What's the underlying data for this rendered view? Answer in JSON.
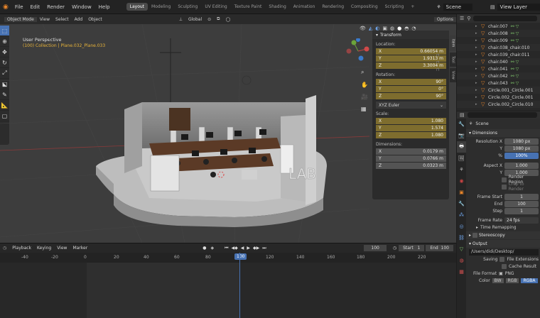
{
  "menubar": {
    "menus": [
      "File",
      "Edit",
      "Render",
      "Window",
      "Help"
    ],
    "workspaces": [
      "Layout",
      "Modeling",
      "Sculpting",
      "UV Editing",
      "Texture Paint",
      "Shading",
      "Animation",
      "Rendering",
      "Compositing",
      "Scripting"
    ],
    "active_workspace": "Layout",
    "scene": "Scene",
    "view_layer": "View Layer"
  },
  "viewport": {
    "mode": "Object Mode",
    "menus": [
      "View",
      "Select",
      "Add",
      "Object"
    ],
    "transform_orientation": "Global",
    "options_label": "Options",
    "view_name": "User Perspective",
    "collection_path": "(100) Collection | Plane.032_Plane.033"
  },
  "npanel": {
    "title": "Transform",
    "location_label": "Location:",
    "location": [
      {
        "axis": "X",
        "value": "0.66054 m"
      },
      {
        "axis": "Y",
        "value": "1.9313 m"
      },
      {
        "axis": "Z",
        "value": "3.3004 m"
      }
    ],
    "rotation_label": "Rotation:",
    "rotation": [
      {
        "axis": "X",
        "value": "90°"
      },
      {
        "axis": "Y",
        "value": "0°"
      },
      {
        "axis": "Z",
        "value": "90°"
      }
    ],
    "rotation_mode": "XYZ Euler",
    "scale_label": "Scale:",
    "scale": [
      {
        "axis": "X",
        "value": "1.080"
      },
      {
        "axis": "Y",
        "value": "1.574"
      },
      {
        "axis": "Z",
        "value": "1.080"
      }
    ],
    "dimensions_label": "Dimensions:",
    "dimensions": [
      {
        "axis": "X",
        "value": "0.0179 m"
      },
      {
        "axis": "Y",
        "value": "0.0766 m"
      },
      {
        "axis": "Z",
        "value": "0.0323 m"
      }
    ],
    "tabs": [
      "Item",
      "Tool",
      "View"
    ]
  },
  "timeline": {
    "menus": [
      "Playback",
      "Keying",
      "View",
      "Marker"
    ],
    "current_frame": "100",
    "start_label": "Start",
    "start": "1",
    "end_label": "End",
    "end": "100",
    "ruler_ticks": [
      "-40",
      "-20",
      "0",
      "20",
      "40",
      "60",
      "80",
      "100",
      "120",
      "140",
      "160",
      "180",
      "200",
      "220"
    ]
  },
  "outliner": {
    "items": [
      {
        "name": "chair.007"
      },
      {
        "name": "chair.008"
      },
      {
        "name": "chair.009"
      },
      {
        "name": "chair.038_chair.010"
      },
      {
        "name": "chair.039_chair.011"
      },
      {
        "name": "chair.040"
      },
      {
        "name": "chair.041"
      },
      {
        "name": "chair.042"
      },
      {
        "name": "chair.043"
      },
      {
        "name": "Circle.001_Circle.001"
      },
      {
        "name": "Circle.002_Circle.001"
      },
      {
        "name": "Circle.002_Circle.010"
      }
    ]
  },
  "properties": {
    "scene_label": "Scene",
    "dimensions_header": "Dimensions",
    "resolution_x_label": "Resolution X",
    "resolution_x": "1080 px",
    "resolution_y_label": "Y",
    "resolution_y": "1080 px",
    "percent_label": "%",
    "percent": "100%",
    "aspect_x_label": "Aspect X",
    "aspect_x": "1.000",
    "aspect_y_label": "Y",
    "aspect_y": "1.000",
    "render_region": "Render Region",
    "crop_to_render": "Crop to Render",
    "frame_start_label": "Frame Start",
    "frame_start": "1",
    "end_label": "End",
    "end": "100",
    "step_label": "Step",
    "step": "1",
    "frame_rate_label": "Frame Rate",
    "frame_rate": "24 fps",
    "time_remapping": "Time Remapping",
    "stereoscopy": "Stereoscopy",
    "output_header": "Output",
    "output_path": "/Users/didi/Desktop/",
    "saving_label": "Saving",
    "file_extensions": "File Extensions",
    "cache_result": "Cache Result",
    "file_format_label": "File Format",
    "file_format": "PNG",
    "color_label": "Color",
    "color_modes": [
      "BW",
      "RGB",
      "RGBA"
    ]
  },
  "scene_text": "LAB"
}
